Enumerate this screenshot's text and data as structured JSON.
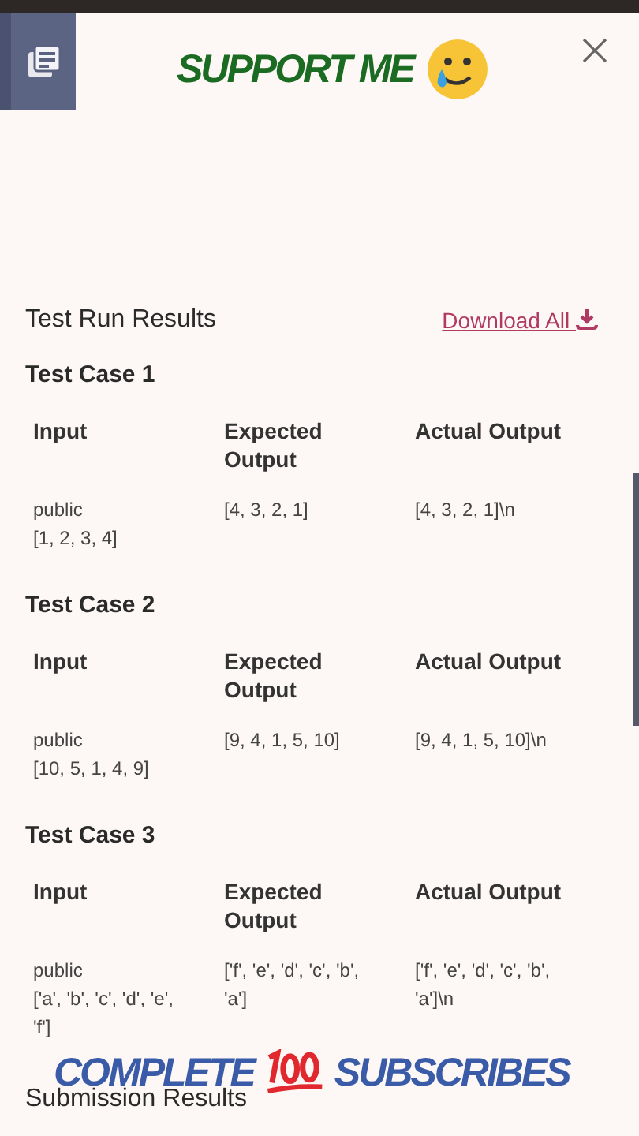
{
  "overlay": {
    "top_text": "SUPPORT ME",
    "bottom_left_text": "COMPLETE",
    "bottom_right_text": "SUBSCRIBES"
  },
  "results": {
    "title": "Test Run Results",
    "download_link": "Download All"
  },
  "test_cases": [
    {
      "title": "Test Case 1",
      "columns": [
        "Input",
        "Expected Output",
        "Actual Output"
      ],
      "values": [
        "public\n[1, 2, 3, 4]",
        "[4, 3, 2, 1]",
        "[4, 3, 2, 1]\\n"
      ]
    },
    {
      "title": "Test Case 2",
      "columns": [
        "Input",
        "Expected Output",
        "Actual Output"
      ],
      "values": [
        "public\n[10, 5, 1, 4, 9]",
        "[9, 4, 1, 5, 10]",
        "[9, 4, 1, 5, 10]\\n"
      ]
    },
    {
      "title": "Test Case 3",
      "columns": [
        "Input",
        "Expected Output",
        "Actual Output"
      ],
      "values": [
        "public\n['a', 'b', 'c', 'd', 'e', 'f']",
        "['f', 'e', 'd', 'c', 'b', 'a']",
        "['f', 'e', 'd', 'c', 'b', 'a']\\n"
      ]
    }
  ],
  "submission": {
    "title": "Submission Results"
  }
}
